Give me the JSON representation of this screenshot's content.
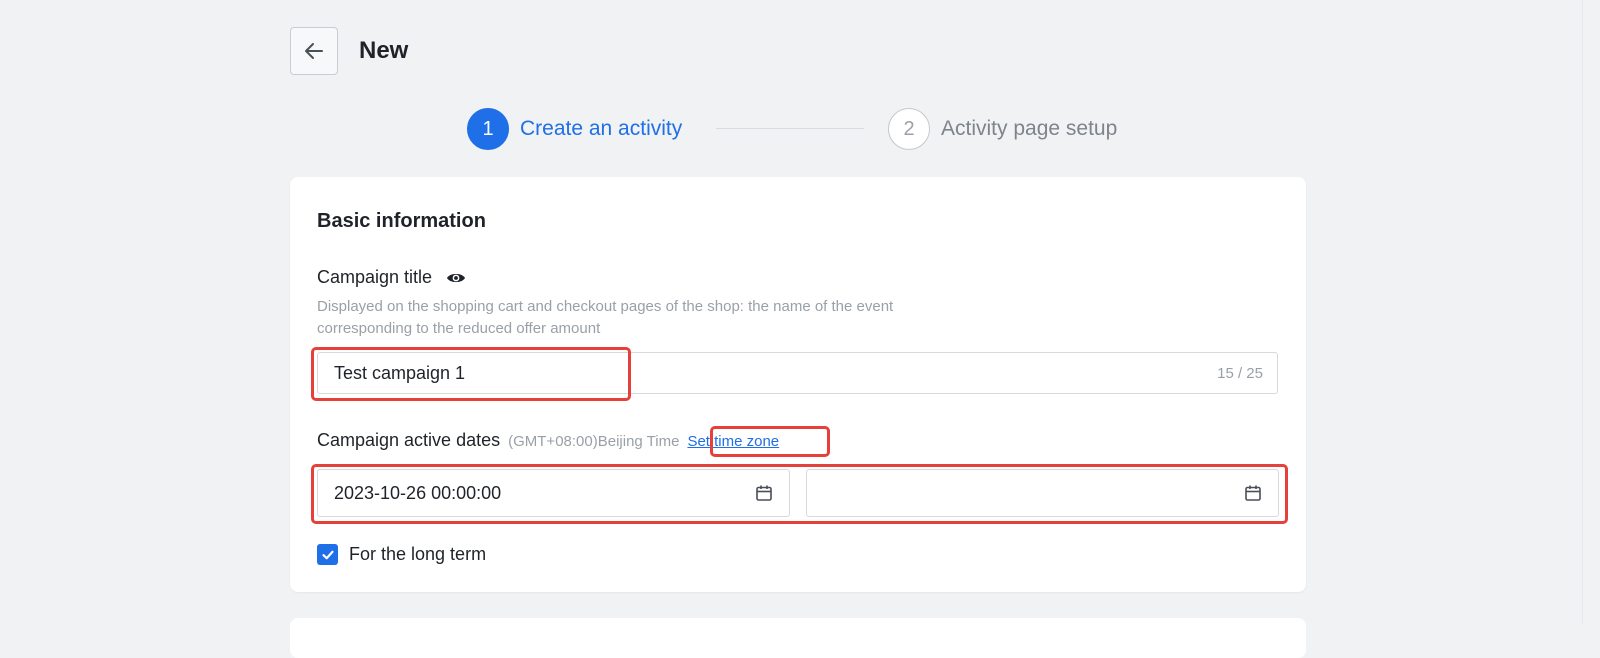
{
  "header": {
    "title": "New",
    "back_icon": "arrow-left-icon"
  },
  "steps": [
    {
      "number": "1",
      "label": "Create an activity",
      "state": "active"
    },
    {
      "number": "2",
      "label": "Activity page setup",
      "state": "inactive"
    }
  ],
  "basic_info": {
    "section_title": "Basic information",
    "campaign_title": {
      "label": "Campaign title",
      "help": "Displayed on the shopping cart and checkout pages of the shop: the name of the event corresponding to the reduced offer amount",
      "value": "Test campaign 1",
      "counter": "15 / 25"
    },
    "active_dates": {
      "label": "Campaign active dates",
      "timezone": "(GMT+08:00)Beijing Time",
      "set_timezone_link": "Set time zone",
      "start_value": "2023-10-26 00:00:00",
      "end_value": ""
    },
    "long_term": {
      "label": "For the long term",
      "checked": true
    }
  },
  "colors": {
    "accent": "#1f6fe8",
    "highlight": "#e5403a"
  }
}
